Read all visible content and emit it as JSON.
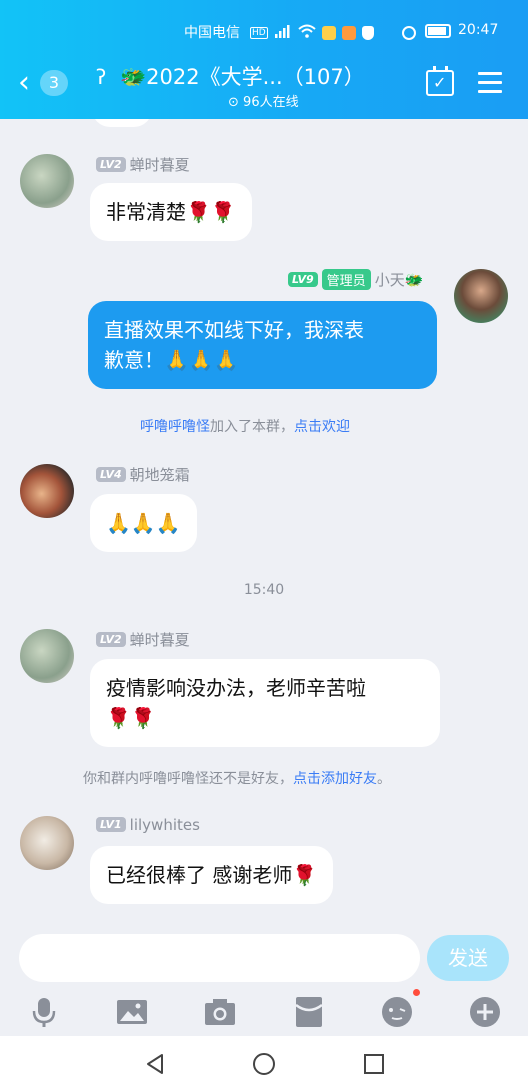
{
  "status_bar": {
    "carrier": "中国电信",
    "time": "20:47"
  },
  "header": {
    "back_badge": "3",
    "title": "🐲2022《大学...（107）",
    "online": "96人在线"
  },
  "messages": [
    {
      "id": "m1",
      "level": "LV2",
      "sender": "蝉时暮夏",
      "text": "非常清楚🌹🌹"
    },
    {
      "id": "m2",
      "level": "LV9",
      "role": "管理员",
      "sender": "小天🐲",
      "text_line1": "直播效果不如线下好，我深表",
      "text_line2": "歉意！🙏🙏🙏"
    },
    {
      "id": "m3",
      "level": "LV4",
      "sender": "朝地笼霜",
      "text": "🙏🙏🙏"
    },
    {
      "id": "m4",
      "level": "LV2",
      "sender": "蝉时暮夏",
      "text_line1": "疫情影响没办法，老师辛苦啦",
      "text_line2": "🌹🌹"
    },
    {
      "id": "m5",
      "level": "LV1",
      "sender": "lilywhites",
      "text": "已经很棒了 感谢老师🌹"
    }
  ],
  "system": {
    "join_name": "呼噜呼噜怪",
    "join_text": "加入了本群，",
    "join_link": "点击欢迎",
    "friend_text": "你和群内呼噜呼噜怪还不是好友，",
    "friend_link": "点击添加好友",
    "friend_end": "。"
  },
  "time_divider": "15:40",
  "input": {
    "send_label": "发送",
    "tools": [
      "microphone-icon",
      "image-icon",
      "camera-icon",
      "red-packet-icon",
      "emoji-icon",
      "plus-icon"
    ]
  },
  "colors": {
    "header_gradient_start": "#12c3f7",
    "header_gradient_end": "#1a9df4",
    "self_bubble": "#1d9bf0",
    "link": "#3a7cf5",
    "admin_badge": "#37c98b"
  }
}
